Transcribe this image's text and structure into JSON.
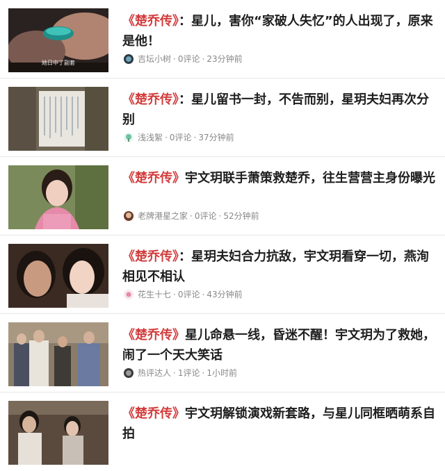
{
  "feed": {
    "items": [
      {
        "tag": "《楚乔传》",
        "title": "：星儿，害你“家破人失忆”的人出现了，原来是他！",
        "author": "吉坛小树",
        "comments": "0评论",
        "time": "23分钟前",
        "thumb_caption": "她日中了副套"
      },
      {
        "tag": "《楚乔传》",
        "title": "：星儿留书一封，不告而别，星玥夫妇再次分别",
        "author": "浅浅絮",
        "comments": "0评论",
        "time": "37分钟前"
      },
      {
        "tag": "《楚乔传》",
        "title": "宇文玥联手萧策救楚乔，往生营营主身份曝光",
        "author": "老牌港星之家",
        "comments": "0评论",
        "time": "52分钟前"
      },
      {
        "tag": "《楚乔传》",
        "title": "：星玥夫妇合力抗敌，宇文玥看穿一切，燕洵相见不相认",
        "author": "花生十七",
        "comments": "0评论",
        "time": "43分钟前"
      },
      {
        "tag": "《楚乔传》",
        "title": "星儿命悬一线，昏迷不醒！宇文玥为了救她，闹了一个天大笑话",
        "author": "热评达人",
        "comments": "1评论",
        "time": "1小时前"
      },
      {
        "tag": "《楚乔传》",
        "title": "宇文玥解锁演戏新套路，与星儿同框晒萌系自拍",
        "author": "",
        "comments": "",
        "time": ""
      }
    ],
    "separator": "·"
  }
}
